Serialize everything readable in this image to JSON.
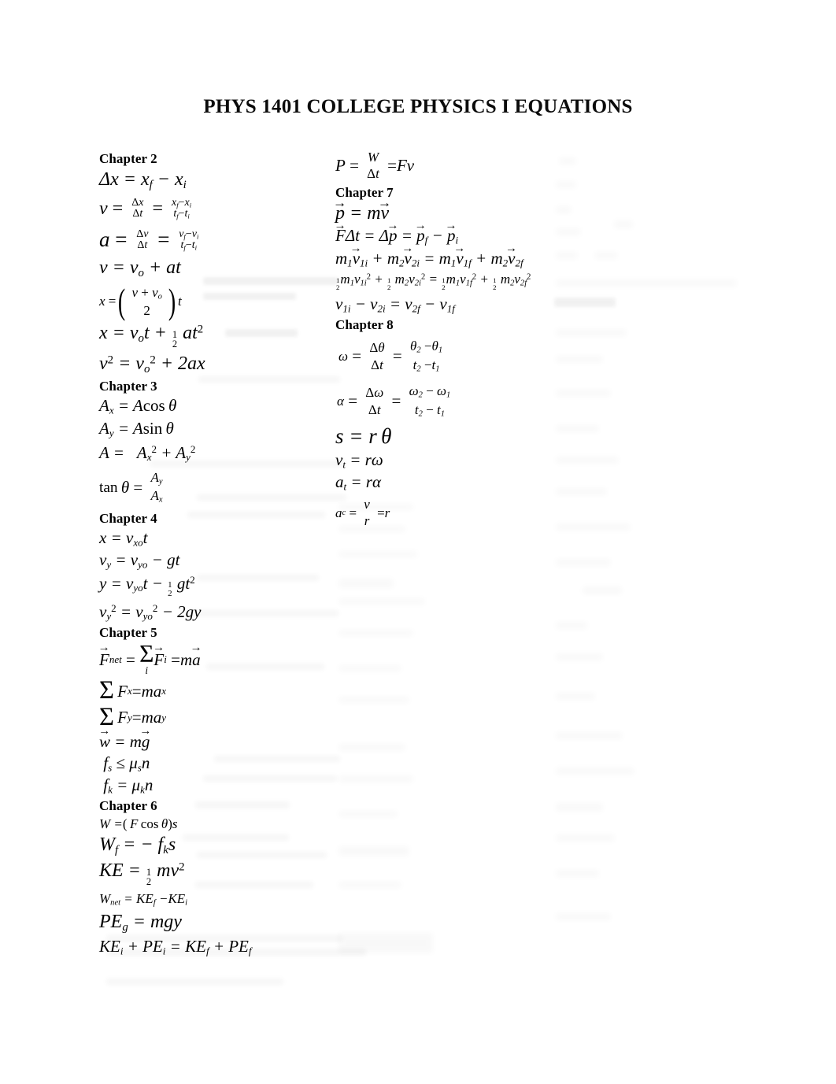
{
  "document": {
    "title": "PHYS 1401 COLLEGE PHYSICS I EQUATIONS",
    "background_color": "#ffffff",
    "text_color": "#000000"
  },
  "columns": {
    "left": {
      "sections": [
        {
          "heading": "Chapter 2",
          "equations": [
            "Δx = x_f − x_i",
            "v = Δx/Δt = (x_f − x_i)/(t_f − t_i)",
            "a = Δv/Δt = (v_f − v_i)/(t_f − t_i)",
            "v = v_o + at",
            "x = ((v + v_o)/2) t",
            "x = v_o t + ½ a t²",
            "v² = v_o² + 2ax"
          ]
        },
        {
          "heading": "Chapter 3",
          "equations": [
            "A_x = A cos θ",
            "A_y = A sin θ",
            "A = √(A_x² + A_y²)",
            "tan θ = A_y / A_x"
          ]
        },
        {
          "heading": "Chapter 4",
          "equations": [
            "x = v_xo t",
            "v_y = v_yo − gt",
            "y = v_yo t − ½ g t²",
            "v_y² = v_yo² − 2gy"
          ]
        },
        {
          "heading": "Chapter 5",
          "equations": [
            "F_net = Σ_i F_i = ma",
            "Σ F_x = m a_x",
            "Σ F_y = m a_y",
            "w = mg",
            "f_s ≤ μ_s n",
            "f_k = μ_k n"
          ]
        },
        {
          "heading": "Chapter 6",
          "equations": [
            "W = (F cos θ)s",
            "W_f = − f_k s",
            "KE = ½ m v²",
            "W_net = KE_f − KE_i",
            "PE_g = mgy",
            "KE_i + PE_i = KE_f + PE_f"
          ]
        }
      ]
    },
    "right": {
      "sections": [
        {
          "heading": "",
          "equations": [
            "P = W/Δt = Fv"
          ]
        },
        {
          "heading": "Chapter 7",
          "equations": [
            "p = mv",
            "FΔt = Δp = p_f − p_i",
            "m₁v₁i + m₂v₂i = m₁v₁f + m₂v₂f",
            "½ m₁ v₁i² + ½ m₂ v₂i² = ½ m₁ v₁f² + ½ m₂ v₂f²",
            "v₁i − v₂i = v₂f − v₁f"
          ]
        },
        {
          "heading": "Chapter 8",
          "equations": [
            "ω = Δθ/Δt = (θ₂ − θ₁)/(t₂ − t₁)",
            "α = Δω/Δt = (ω₂ − ω₁)/(t₂ − t₁)",
            "s = r θ",
            "v_t = r ω",
            "a_t = r α",
            "a_c = v/r = r"
          ]
        }
      ]
    }
  },
  "symbols": {
    "delta": "Δ",
    "theta": "θ",
    "omega": "ω",
    "alpha": "α",
    "mu": "μ",
    "sigma": "Σ",
    "minus": "−",
    "leq": "≤",
    "plus": "+",
    "equals": "=",
    "one": "1",
    "two": "2"
  },
  "labels": {
    "chapter2": "Chapter 2",
    "chapter3": "Chapter 3",
    "chapter4": "Chapter 4",
    "chapter5": "Chapter 5",
    "chapter6": "Chapter 6",
    "chapter7": "Chapter 7",
    "chapter8": "Chapter 8"
  }
}
